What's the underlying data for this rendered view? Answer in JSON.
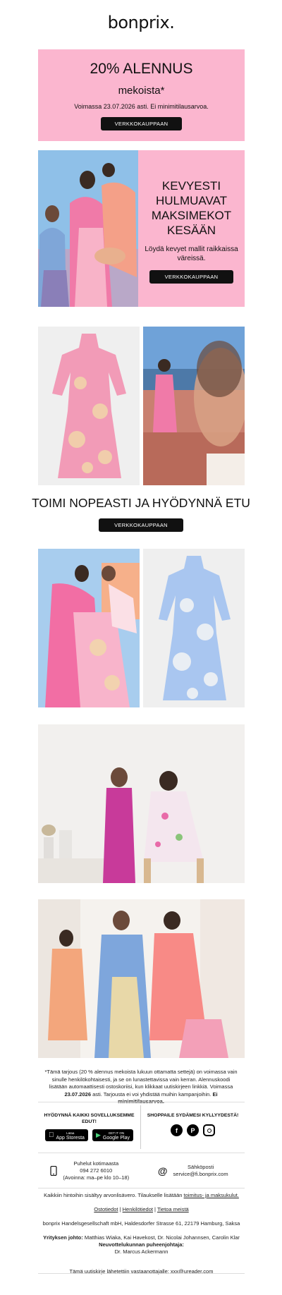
{
  "brand": {
    "logo": "bonprix."
  },
  "promo": {
    "headline": "20% ALENNUS",
    "subheadline": "mekoista*",
    "validity": "Voimassa 23.07.2026 asti. Ei minimitilausarvoa.",
    "button": "VERKKOKAUPPAAN"
  },
  "hero": {
    "title": "KEVYESTI HULMUAVAT MAKSIMEKOT KESÄÄN",
    "description": "Löydä kevyet mallit raikkaissa väreissä.",
    "button": "VERKKOKAUPPAAN"
  },
  "cta": {
    "title": "TOIMI NOPEASTI JA HYÖDYNNÄ ETU",
    "button": "VERKKOKAUPPAAN"
  },
  "disclaimer": {
    "part1": "*Tämä tarjous (20 % alennus mekoista lukuun ottamatta settejä) on voimassa vain sinulle henkilökohtaisesti, ja se on lunastettavissa vain kerran. Alennuskoodi lisätään automaattisesti ostoskoriisi, kun klikkaat uutiskirjeen linkkiä. Voimassa ",
    "date": "23.07.2026",
    "part2": " asti. Tarjousta ei voi yhdistää muihin kampanjoihin. ",
    "bold_end": "Ei minimitilausarvoa."
  },
  "apps": {
    "heading": "HYÖDYNNÄ KAIKKI SOVELLUKSEMME EDUT!",
    "appstore_small": "Lataa",
    "appstore": "App Storesta",
    "googleplay_small": "GET IT ON",
    "googleplay": "Google Play"
  },
  "social": {
    "heading": "SHOPPAILE SYDÄMESI KYLLYYDESTÄ!",
    "facebook": "f",
    "pinterest": "P"
  },
  "contact": {
    "phone_label": "Puhelut kotimaasta",
    "phone_number": "094 272 6010",
    "phone_hours": "(Avoinna: ma–pe klo 10–18)",
    "email_label": "Sähköposti",
    "email_address": "service@fi.bonprix.com"
  },
  "footer": {
    "prices_note": "Kaikkiin hintoihin sisältyy arvonlisävero. Tilaukselle lisätään ",
    "terms_link": "toimitus- ja maksukulut.",
    "link1": "Ostotiedot",
    "link2": "Henkilötiedot",
    "link3": "Tietoa meistä",
    "company": "bonprix Handelsgesellschaft mbH, Haldesdorfer Strasse 61, 22179 Hamburg, Saksa",
    "board_label": "Yrityksen johto:",
    "board": " Matthias Wiaka, Kai Havekost, Dr. Nicolai Johannsen, Carolin Klar",
    "chair_label": "Neuvottelukunnan puheenjohtaja:",
    "chair": "Dr. Marcus Ackermann",
    "sent_to": "Tämä uutiskirje lähetettiin vastaanottajalle: xxx@ureader.com"
  },
  "colors": {
    "pink": "#fbb6cf",
    "black": "#111111"
  }
}
